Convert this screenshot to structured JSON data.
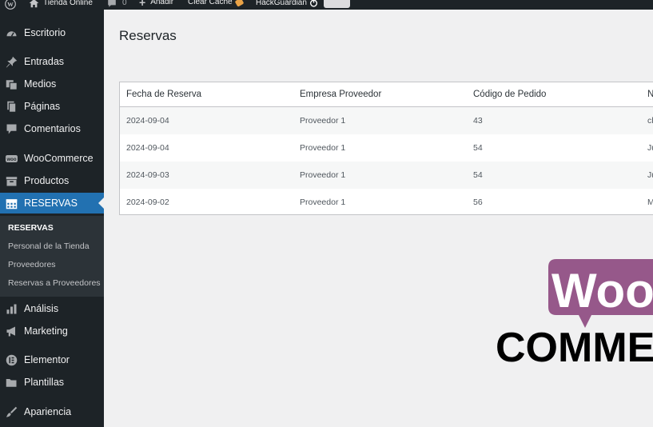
{
  "admin_bar": {
    "site_name": "Tienda Online",
    "comments_count": "0",
    "add_new_label": "Añadir",
    "clear_cache_label": "Clear Cache",
    "hackguardian_label": "HackGuardian"
  },
  "sidebar": {
    "items": [
      {
        "label": "Escritorio",
        "icon": "dashboard-icon"
      },
      {
        "label": "Entradas",
        "icon": "pin-icon"
      },
      {
        "label": "Medios",
        "icon": "media-icon"
      },
      {
        "label": "Páginas",
        "icon": "pages-icon"
      },
      {
        "label": "Comentarios",
        "icon": "comments-icon"
      },
      {
        "label": "WooCommerce",
        "icon": "woocommerce-icon"
      },
      {
        "label": "Productos",
        "icon": "products-icon"
      },
      {
        "label": "RESERVAS",
        "icon": "calendar-icon"
      },
      {
        "label": "Análisis",
        "icon": "analytics-icon"
      },
      {
        "label": "Marketing",
        "icon": "megaphone-icon"
      },
      {
        "label": "Elementor",
        "icon": "elementor-icon"
      },
      {
        "label": "Plantillas",
        "icon": "folder-icon"
      },
      {
        "label": "Apariencia",
        "icon": "paintbrush-icon"
      }
    ],
    "submenu": [
      "RESERVAS",
      "Personal de la Tienda",
      "Proveedores",
      "Reservas a Proveedores"
    ]
  },
  "page": {
    "title": "Reservas"
  },
  "table": {
    "headers": [
      "Fecha de Reserva",
      "Empresa Proveedor",
      "Código de Pedido",
      "N"
    ],
    "rows": [
      [
        "2024-09-04",
        "Proveedor 1",
        "43",
        "ch"
      ],
      [
        "2024-09-04",
        "Proveedor 1",
        "54",
        "Ju"
      ],
      [
        "2024-09-03",
        "Proveedor 1",
        "54",
        "Ju"
      ],
      [
        "2024-09-02",
        "Proveedor 1",
        "56",
        "M"
      ]
    ]
  },
  "logo": {
    "top_text": "Woo",
    "bottom_text": "COMMERCE"
  },
  "colors": {
    "sidebar_bg": "#1d2327",
    "active_blue": "#2271b1",
    "woo_purple": "#96588a"
  }
}
